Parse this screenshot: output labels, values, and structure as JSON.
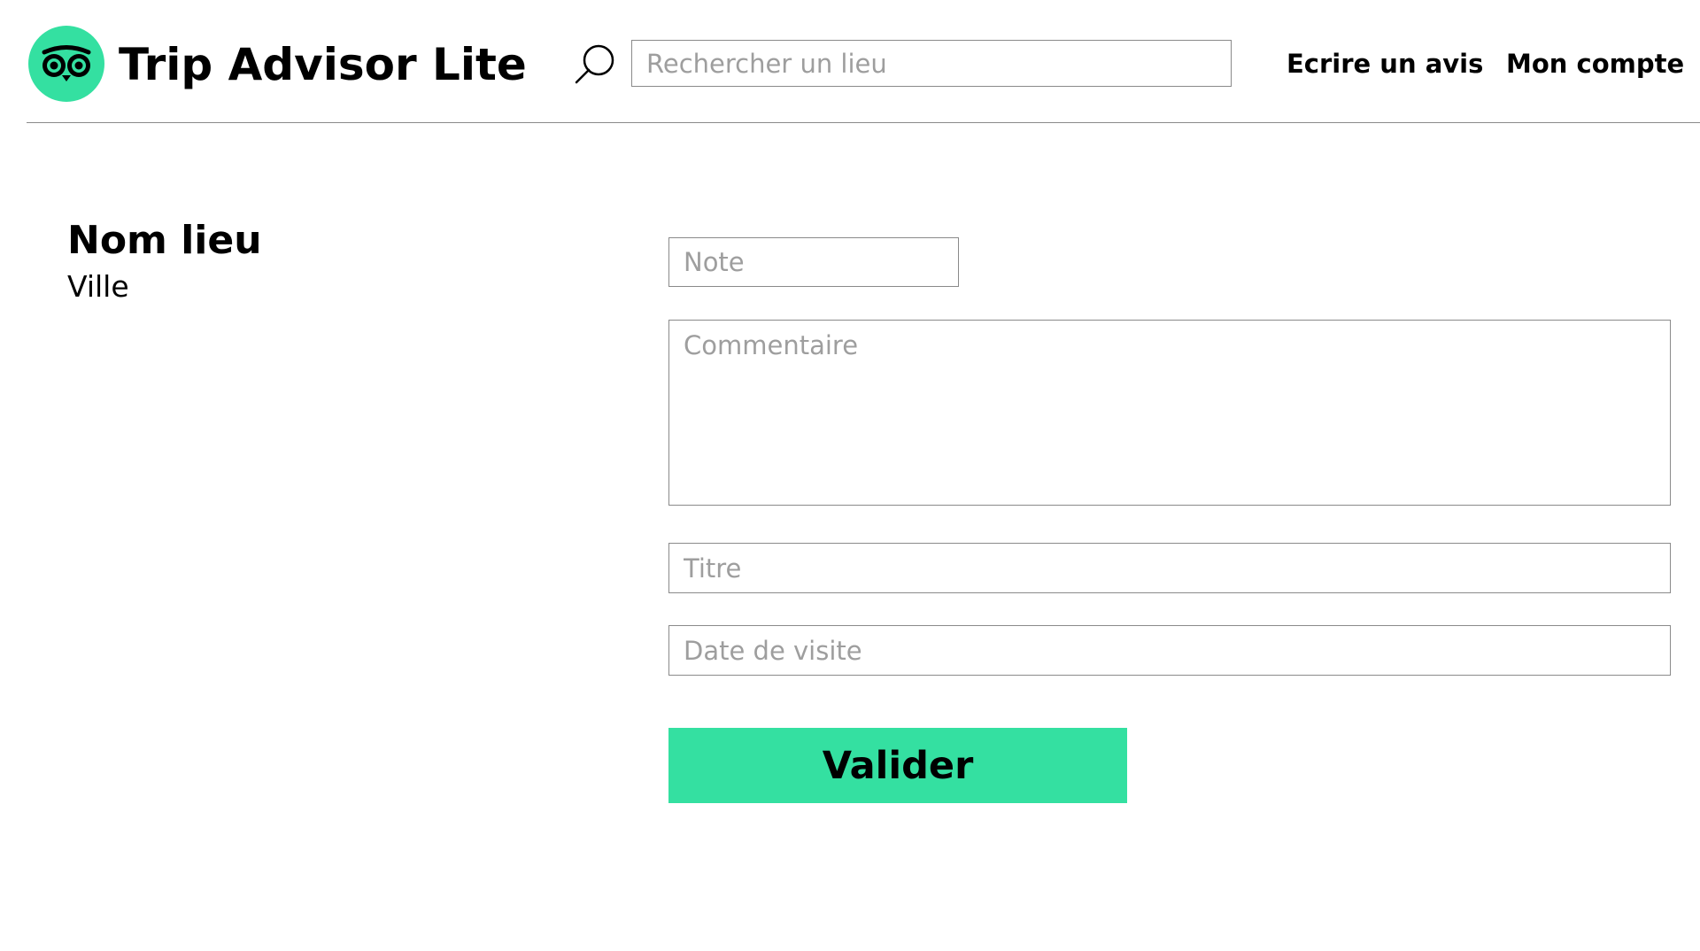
{
  "header": {
    "brand": "Trip Advisor Lite",
    "logo_icon": "owl-logo-icon",
    "logo_color": "#34e0a1",
    "search": {
      "icon": "search-icon",
      "placeholder": "Rechercher un lieu",
      "value": ""
    },
    "nav": {
      "write_review": "Ecrire un avis",
      "account": "Mon compte"
    }
  },
  "place": {
    "name": "Nom lieu",
    "city": "Ville"
  },
  "form": {
    "note_placeholder": "Note",
    "comment_placeholder": "Commentaire",
    "title_placeholder": "Titre",
    "date_placeholder": "Date de visite",
    "submit_label": "Valider",
    "accent_color": "#34e0a1"
  }
}
